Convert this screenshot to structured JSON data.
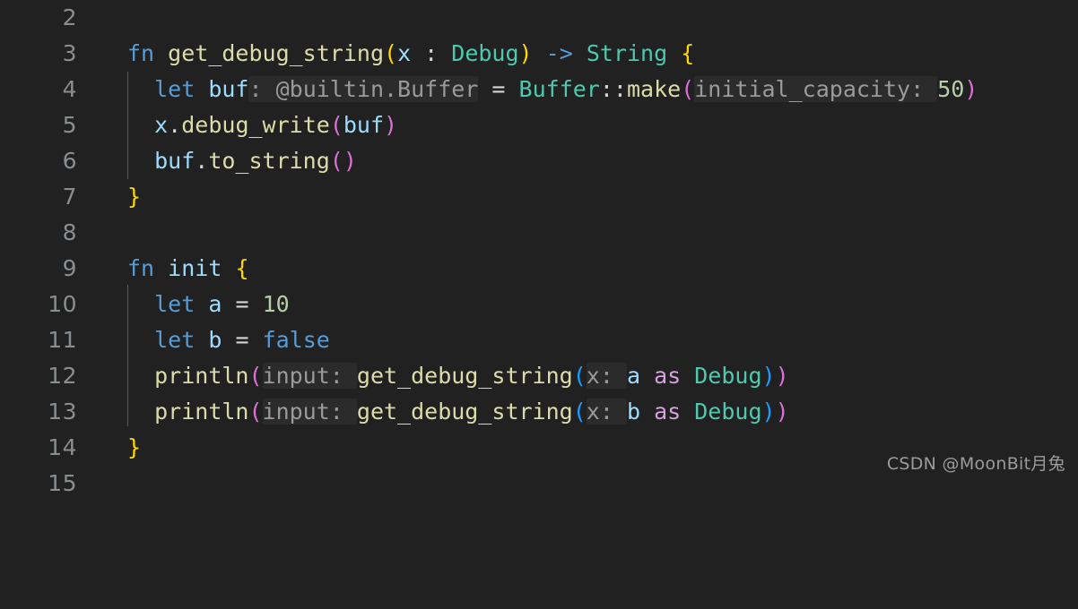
{
  "editor": {
    "background_color": "#212121",
    "line_number_color": "#888e91",
    "indent_guide_color": "#5a5a5a",
    "first_visible_line": 2,
    "last_visible_line": 15,
    "language": "MoonBit"
  },
  "line_numbers": [
    "2",
    "3",
    "4",
    "5",
    "6",
    "7",
    "8",
    "9",
    "10",
    "11",
    "12",
    "13",
    "14",
    "15"
  ],
  "lines": [
    {
      "number": "2",
      "text": ""
    },
    {
      "number": "3",
      "text": "fn get_debug_string(x : Debug) -> String {"
    },
    {
      "number": "4",
      "text": "  let buf: @builtin.Buffer = Buffer::make(initial_capacity: 50)"
    },
    {
      "number": "5",
      "text": "  x.debug_write(buf)"
    },
    {
      "number": "6",
      "text": "  buf.to_string()"
    },
    {
      "number": "7",
      "text": "}"
    },
    {
      "number": "8",
      "text": ""
    },
    {
      "number": "9",
      "text": "fn init {"
    },
    {
      "number": "10",
      "text": "  let a = 10"
    },
    {
      "number": "11",
      "text": "  let b = false"
    },
    {
      "number": "12",
      "text": "  println(input: get_debug_string(x: a as Debug))"
    },
    {
      "number": "13",
      "text": "  println(input: get_debug_string(x: b as Debug))"
    },
    {
      "number": "14",
      "text": "}"
    },
    {
      "number": "15",
      "text": ""
    }
  ],
  "tokens": {
    "kw_fn": "fn",
    "kw_let": "let",
    "kw_false": "false",
    "kw_as": "as",
    "fn_get_debug_string": "get_debug_string",
    "fn_make": "make",
    "fn_debug_write": "debug_write",
    "fn_to_string": "to_string",
    "fn_println": "println",
    "id_init": "init",
    "id_x": "x",
    "id_buf": "buf",
    "id_a": "a",
    "id_b": "b",
    "type_debug": "Debug",
    "type_string": "String",
    "type_buffer": "Buffer",
    "num_50": "50",
    "num_10": "10",
    "op_arrow": "->",
    "op_eq": "=",
    "op_colon": " : ",
    "op_dcolon": "::",
    "op_dot": ".",
    "paren_open": "(",
    "paren_close": ")",
    "brace_open": "{",
    "brace_close": "}"
  },
  "inlay_hints": {
    "type_hint_buf": ": @builtin.Buffer",
    "param_initial_capacity": "initial_capacity: ",
    "param_input_1": "input: ",
    "param_input_2": "input: ",
    "param_x_1": "x: ",
    "param_x_2": "x: "
  },
  "watermark": {
    "text": "CSDN @MoonBit月兔"
  },
  "colors": {
    "keyword": "#569cd6",
    "function": "#dcdcaa",
    "type": "#4ec9b0",
    "variable": "#9cdcfe",
    "number": "#b5cea8",
    "keyword_as": "#d7a0df",
    "bracket_level_1": "#ffd700",
    "bracket_level_2": "#da70d6",
    "bracket_level_3": "#179fff",
    "inlay_hint_text": "#9a9a9a",
    "inlay_hint_bg": "#2b2b2b",
    "default_text": "#d4d4d4"
  }
}
